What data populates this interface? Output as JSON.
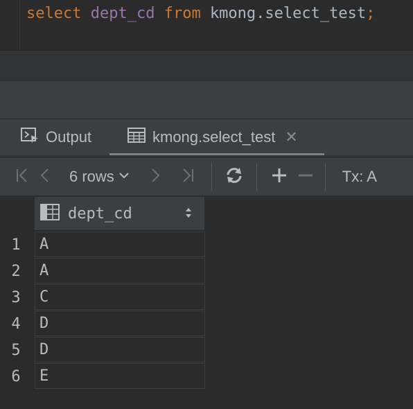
{
  "editor": {
    "kw_select": "select",
    "column": "dept_cd",
    "kw_from": "from",
    "table": "kmong.select_test",
    "semicolon": ";"
  },
  "tabs": [
    {
      "label": "Output",
      "icon": "console-icon"
    },
    {
      "label": "kmong.select_test",
      "icon": "table-icon",
      "active": true
    }
  ],
  "toolbar": {
    "rows_label": "6 rows",
    "tx_label": "Tx: A"
  },
  "grid": {
    "columns": [
      "dept_cd"
    ],
    "rows": [
      {
        "num": "1",
        "dept_cd": "A"
      },
      {
        "num": "2",
        "dept_cd": "A"
      },
      {
        "num": "3",
        "dept_cd": "C"
      },
      {
        "num": "4",
        "dept_cd": "D"
      },
      {
        "num": "5",
        "dept_cd": "D"
      },
      {
        "num": "6",
        "dept_cd": "E"
      }
    ]
  }
}
